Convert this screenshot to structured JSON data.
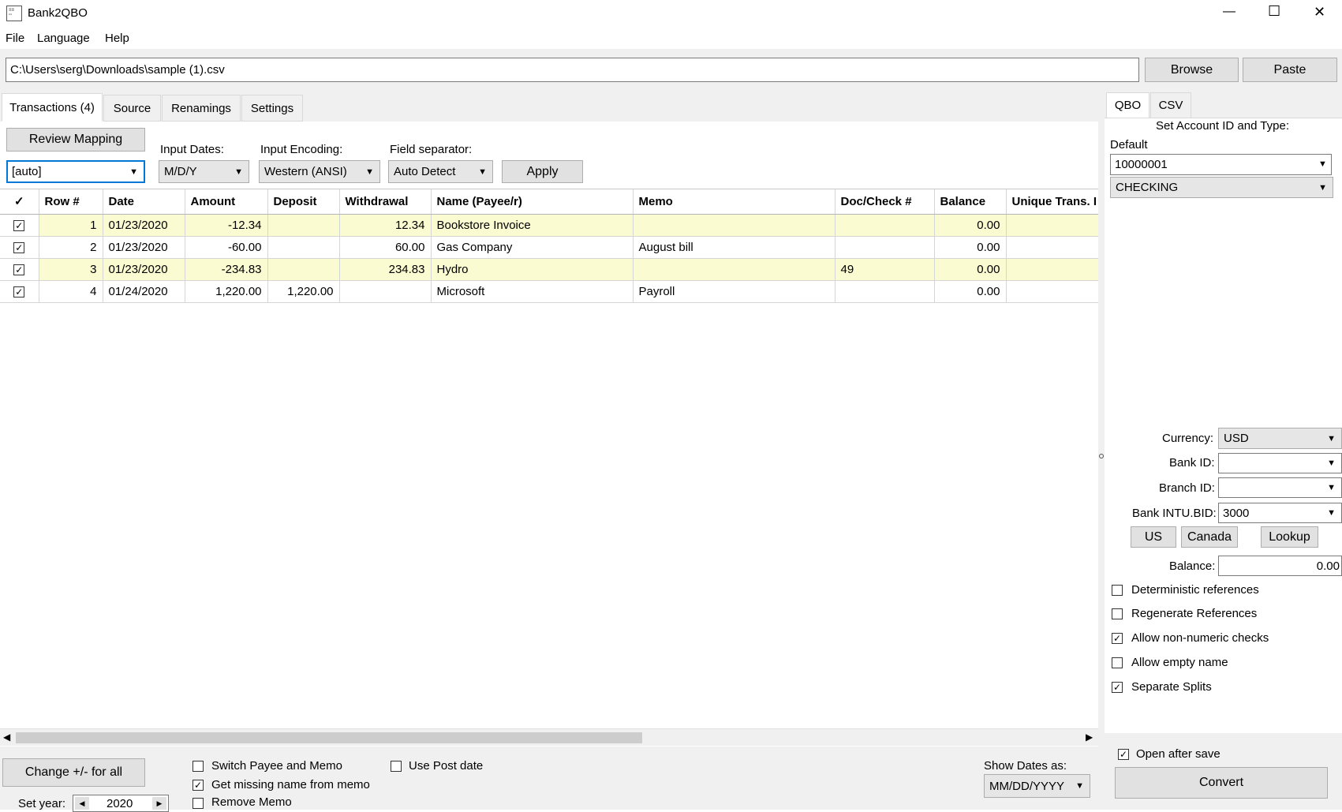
{
  "window": {
    "title": "Bank2QBO",
    "minimize": "—",
    "maximize": "☐",
    "close": "✕"
  },
  "menu": [
    "File",
    "Language",
    "Help"
  ],
  "file_path": "C:\\Users\\serg\\Downloads\\sample (1).csv",
  "browse_label": "Browse",
  "paste_label": "Paste",
  "tabs": [
    "Transactions (4)",
    "Source",
    "Renamings",
    "Settings"
  ],
  "review_mapping_label": "Review Mapping",
  "mapping_value": "[auto]",
  "input_dates": {
    "label": "Input Dates:",
    "value": "M/D/Y"
  },
  "input_encoding": {
    "label": "Input Encoding:",
    "value": "Western (ANSI)"
  },
  "field_separator": {
    "label": "Field separator:",
    "value": "Auto Detect"
  },
  "apply_label": "Apply",
  "table": {
    "columns": [
      "✓",
      "Row #",
      "Date",
      "Amount",
      "Deposit",
      "Withdrawal",
      "Name (Payee/r)",
      "Memo",
      "Doc/Check #",
      "Balance",
      "Unique Trans. I"
    ],
    "rows": [
      {
        "row": "1",
        "date": "01/23/2020",
        "amount": "-12.34",
        "deposit": "",
        "withdrawal": "12.34",
        "name": "Bookstore Invoice",
        "memo": "",
        "doc": "",
        "balance": "0.00",
        "unique": ""
      },
      {
        "row": "2",
        "date": "01/23/2020",
        "amount": "-60.00",
        "deposit": "",
        "withdrawal": "60.00",
        "name": "Gas Company",
        "memo": "August bill",
        "doc": "",
        "balance": "0.00",
        "unique": ""
      },
      {
        "row": "3",
        "date": "01/23/2020",
        "amount": "-234.83",
        "deposit": "",
        "withdrawal": "234.83",
        "name": "Hydro",
        "memo": "",
        "doc": "49",
        "balance": "0.00",
        "unique": ""
      },
      {
        "row": "4",
        "date": "01/24/2020",
        "amount": "1,220.00",
        "deposit": "1,220.00",
        "withdrawal": "",
        "name": "Microsoft",
        "memo": "Payroll",
        "doc": "",
        "balance": "0.00",
        "unique": ""
      }
    ]
  },
  "bottom": {
    "change_sign_label": "Change +/- for all",
    "set_year_label": "Set year:",
    "year": "2020",
    "switch_payee_memo": "Switch Payee and Memo",
    "get_missing_name": "Get missing name from memo",
    "remove_memo": "Remove Memo",
    "use_post_date": "Use Post date",
    "show_dates_label": "Show Dates as:",
    "show_dates_value": "MM/DD/YYYY"
  },
  "right": {
    "tabs": [
      "QBO",
      "CSV"
    ],
    "set_account_label": "Set Account ID and Type:",
    "default_label": "Default",
    "account_id": "10000001",
    "account_type": "CHECKING",
    "currency_label": "Currency:",
    "currency_value": "USD",
    "bank_id_label": "Bank ID:",
    "bank_id_value": "",
    "branch_id_label": "Branch ID:",
    "branch_id_value": "",
    "intu_bid_label": "Bank INTU.BID:",
    "intu_bid_value": "3000",
    "us_label": "US",
    "canada_label": "Canada",
    "lookup_label": "Lookup",
    "balance_label": "Balance:",
    "balance_value": "0.00",
    "options": [
      {
        "label": "Deterministic references",
        "checked": false
      },
      {
        "label": "Regenerate References",
        "checked": false
      },
      {
        "label": "Allow non-numeric checks",
        "checked": true
      },
      {
        "label": "Allow empty name",
        "checked": false
      },
      {
        "label": "Separate Splits",
        "checked": true
      }
    ],
    "open_after_save": "Open after save",
    "convert_label": "Convert"
  }
}
